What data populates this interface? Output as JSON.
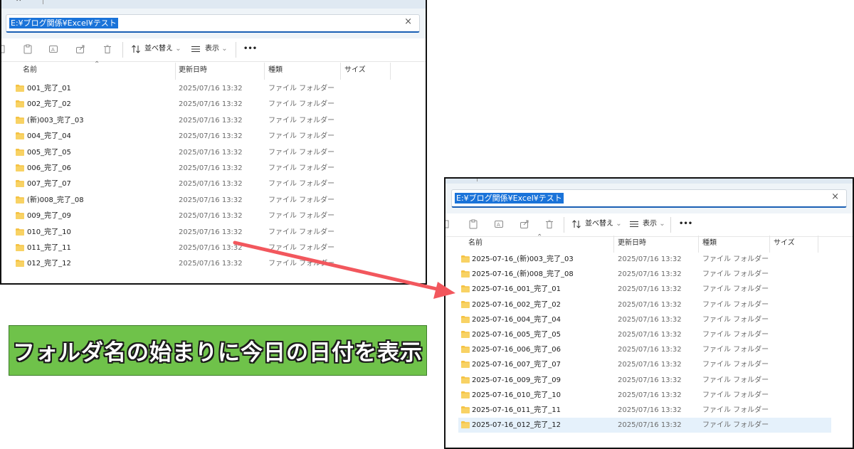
{
  "before": {
    "address": "E:¥ブログ関係¥Excel¥テスト",
    "toolbar": {
      "sort_label": "並べ替え",
      "view_label": "表示",
      "more_label": "•••"
    },
    "columns": {
      "name": "名前",
      "date": "更新日時",
      "type": "種類",
      "size": "サイズ"
    },
    "rows": [
      {
        "name": "001_完了_01",
        "date": "2025/07/16 13:32",
        "type": "ファイル フォルダー"
      },
      {
        "name": "002_完了_02",
        "date": "2025/07/16 13:32",
        "type": "ファイル フォルダー"
      },
      {
        "name": "(新)003_完了_03",
        "date": "2025/07/16 13:32",
        "type": "ファイル フォルダー"
      },
      {
        "name": "004_完了_04",
        "date": "2025/07/16 13:32",
        "type": "ファイル フォルダー"
      },
      {
        "name": "005_完了_05",
        "date": "2025/07/16 13:32",
        "type": "ファイル フォルダー"
      },
      {
        "name": "006_完了_06",
        "date": "2025/07/16 13:32",
        "type": "ファイル フォルダー"
      },
      {
        "name": "007_完了_07",
        "date": "2025/07/16 13:32",
        "type": "ファイル フォルダー"
      },
      {
        "name": "(新)008_完了_08",
        "date": "2025/07/16 13:32",
        "type": "ファイル フォルダー"
      },
      {
        "name": "009_完了_09",
        "date": "2025/07/16 13:32",
        "type": "ファイル フォルダー"
      },
      {
        "name": "010_完了_10",
        "date": "2025/07/16 13:32",
        "type": "ファイル フォルダー"
      },
      {
        "name": "011_完了_11",
        "date": "2025/07/16 13:32",
        "type": "ファイル フォルダー"
      },
      {
        "name": "012_完了_12",
        "date": "2025/07/16 13:32",
        "type": "ファイル フォルダー"
      }
    ]
  },
  "after": {
    "address": "E:¥ブログ関係¥Excel¥テスト",
    "toolbar": {
      "sort_label": "並べ替え",
      "view_label": "表示",
      "more_label": "•••"
    },
    "columns": {
      "name": "名前",
      "date": "更新日時",
      "type": "種類",
      "size": "サイズ"
    },
    "rows": [
      {
        "name": "2025-07-16_(新)003_完了_03",
        "date": "2025/07/16 13:32",
        "type": "ファイル フォルダー"
      },
      {
        "name": "2025-07-16_(新)008_完了_08",
        "date": "2025/07/16 13:32",
        "type": "ファイル フォルダー"
      },
      {
        "name": "2025-07-16_001_完了_01",
        "date": "2025/07/16 13:32",
        "type": "ファイル フォルダー"
      },
      {
        "name": "2025-07-16_002_完了_02",
        "date": "2025/07/16 13:32",
        "type": "ファイル フォルダー"
      },
      {
        "name": "2025-07-16_004_完了_04",
        "date": "2025/07/16 13:32",
        "type": "ファイル フォルダー"
      },
      {
        "name": "2025-07-16_005_完了_05",
        "date": "2025/07/16 13:32",
        "type": "ファイル フォルダー"
      },
      {
        "name": "2025-07-16_006_完了_06",
        "date": "2025/07/16 13:32",
        "type": "ファイル フォルダー"
      },
      {
        "name": "2025-07-16_007_完了_07",
        "date": "2025/07/16 13:32",
        "type": "ファイル フォルダー"
      },
      {
        "name": "2025-07-16_009_完了_09",
        "date": "2025/07/16 13:32",
        "type": "ファイル フォルダー"
      },
      {
        "name": "2025-07-16_010_完了_10",
        "date": "2025/07/16 13:32",
        "type": "ファイル フォルダー"
      },
      {
        "name": "2025-07-16_011_完了_11",
        "date": "2025/07/16 13:32",
        "type": "ファイル フォルダー"
      },
      {
        "name": "2025-07-16_012_完了_12",
        "date": "2025/07/16 13:32",
        "type": "ファイル フォルダー"
      }
    ],
    "selected_row": 11
  },
  "banner": {
    "text": "フォルダ名の始まりに今日の日付を表示"
  },
  "colors": {
    "banner_bg": "#6fc24a",
    "arrow": "#f2575d",
    "selection": "#1a73d9",
    "folder": "#f5c242"
  },
  "icons": [
    "copy-icon",
    "paste-icon",
    "rename-icon",
    "share-icon",
    "delete-icon",
    "sort-icon",
    "view-icon",
    "more-icon",
    "folder-icon",
    "close-icon"
  ]
}
